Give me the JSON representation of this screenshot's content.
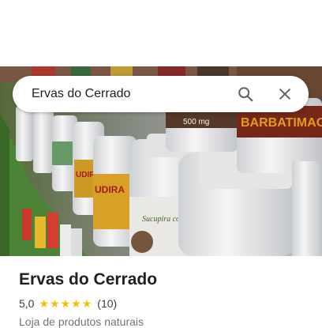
{
  "search": {
    "query": "Ervas do Cerrado"
  },
  "photo": {
    "jar_labels": [
      "UDIRA",
      "UDIRA",
      "Sucupira com Óleo de Magnésio",
      "500 mg",
      "BARBATIMAO",
      "Sucupira"
    ]
  },
  "place": {
    "name": "Ervas do Cerrado",
    "rating": "5,0",
    "stars": 5,
    "review_count": "(10)",
    "category": "Loja de produtos naturais"
  },
  "colors": {
    "star": "#fbbc04",
    "text_primary": "#202124",
    "text_secondary": "#70757a"
  },
  "icons": [
    "search-icon",
    "close-icon",
    "star-icon"
  ]
}
